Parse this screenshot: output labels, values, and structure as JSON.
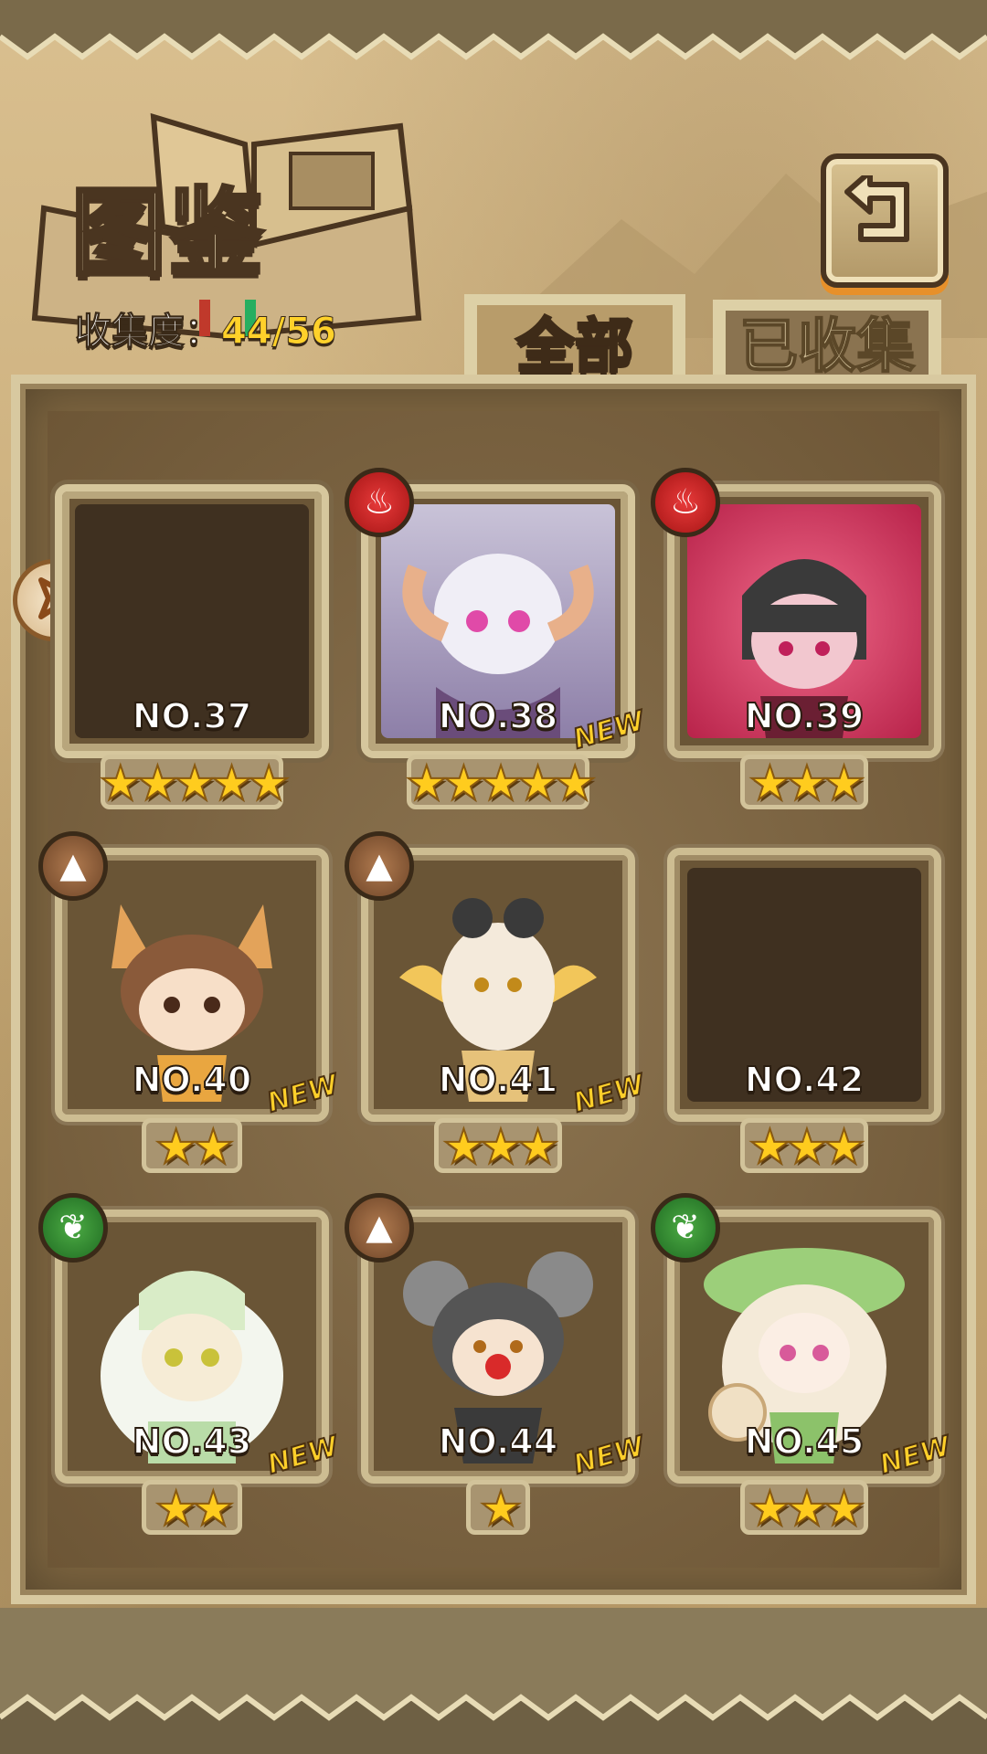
{
  "header": {
    "title": "图鉴",
    "collection_label": "收集度：",
    "collection_count": "44/56"
  },
  "tabs": [
    {
      "label": "全部",
      "active": true
    },
    {
      "label": "已收集",
      "active": false
    }
  ],
  "cards": [
    {
      "number": "NO.37",
      "stars": "★★★★★",
      "star_count": 5,
      "element": "",
      "collected": false,
      "new_label": ""
    },
    {
      "number": "NO.38",
      "stars": "★★★★★",
      "star_count": 5,
      "element": "fire-icon",
      "collected": true,
      "new_label": "NEW"
    },
    {
      "number": "NO.39",
      "stars": "★★★",
      "star_count": 3,
      "element": "fire-icon",
      "collected": true,
      "new_label": ""
    },
    {
      "number": "NO.40",
      "stars": "★★",
      "star_count": 2,
      "element": "earth-icon",
      "collected": true,
      "new_label": "NEW"
    },
    {
      "number": "NO.41",
      "stars": "★★★",
      "star_count": 3,
      "element": "earth-icon",
      "collected": true,
      "new_label": "NEW"
    },
    {
      "number": "NO.42",
      "stars": "★★★",
      "star_count": 3,
      "element": "",
      "collected": false,
      "new_label": ""
    },
    {
      "number": "NO.43",
      "stars": "★★",
      "star_count": 2,
      "element": "nature-icon",
      "collected": true,
      "new_label": "NEW"
    },
    {
      "number": "NO.44",
      "stars": "★",
      "star_count": 1,
      "element": "earth-icon",
      "collected": true,
      "new_label": "NEW"
    },
    {
      "number": "NO.45",
      "stars": "★★★",
      "star_count": 3,
      "element": "nature-icon",
      "collected": true,
      "new_label": "NEW"
    }
  ],
  "colors": {
    "fire": "#d42a2a",
    "earth": "#8b5a36",
    "nature": "#2e8a2e",
    "star": "#ffcc1e",
    "new": "#ffd02a",
    "collection_count": "#ffd12a"
  }
}
